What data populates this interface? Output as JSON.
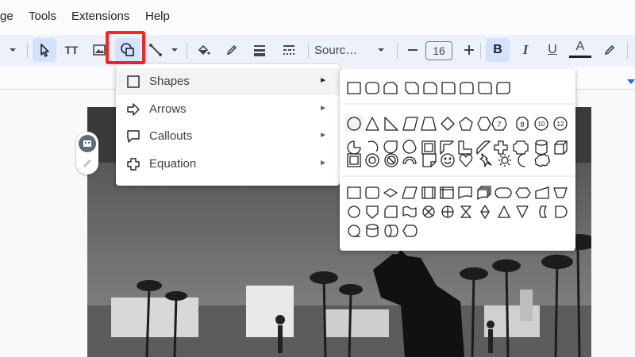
{
  "menubar": {
    "items": [
      "ge",
      "Tools",
      "Extensions",
      "Help"
    ]
  },
  "toolbar": {
    "font_name": "Sourc…",
    "font_size": "16",
    "bold_label": "B",
    "italic_label": "I",
    "underline_label": "U",
    "text_color_label": "A",
    "text_style_label": "TT"
  },
  "insert_menu": {
    "items": [
      {
        "label": "Shapes",
        "icon": "square-icon"
      },
      {
        "label": "Arrows",
        "icon": "arrow-right-icon"
      },
      {
        "label": "Callouts",
        "icon": "callout-icon"
      },
      {
        "label": "Equation",
        "icon": "plus-icon"
      }
    ],
    "submenu_glyph": "►"
  },
  "colors": {
    "highlight": "#ff2020",
    "selected_tool": "#d3e3fd",
    "toolbar_bg": "#edf2fa"
  }
}
